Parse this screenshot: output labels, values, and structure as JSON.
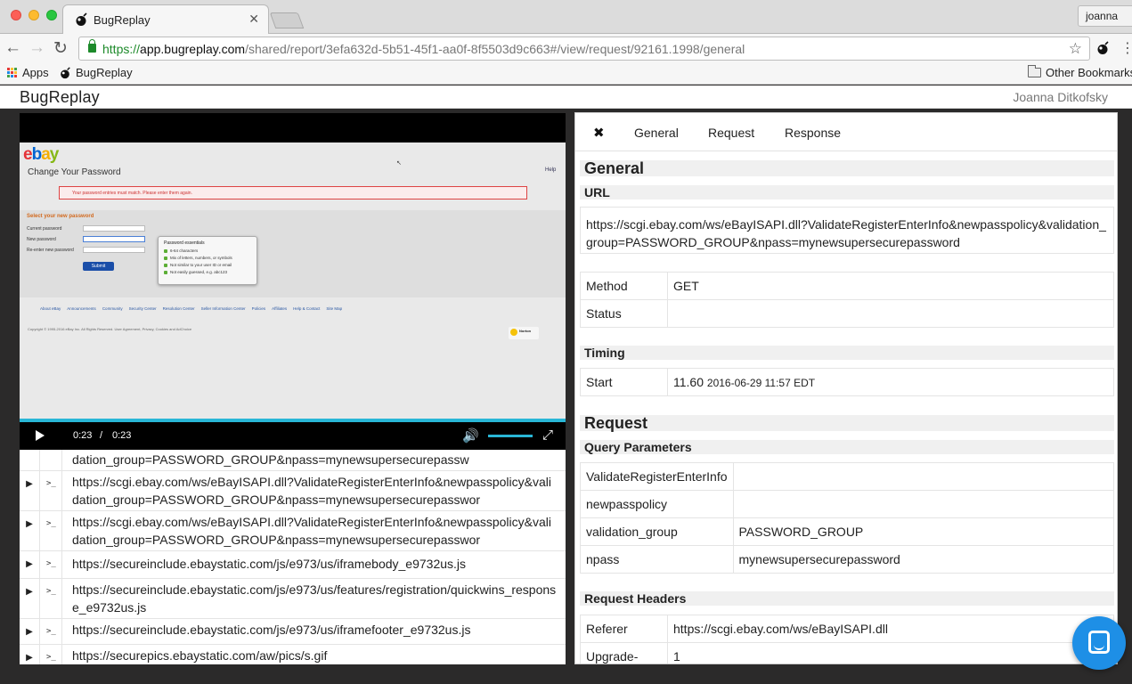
{
  "browser": {
    "tab_title": "BugReplay",
    "tab_close": "✕",
    "profile_name": "joanna",
    "url_scheme": "https://",
    "url_host": "app.bugreplay.com",
    "url_path": "/shared/report/3efa632d-5b51-45f1-aa0f-8f5503d9c663#/view/request/92161.1998/general",
    "bookmarks": {
      "apps": "Apps",
      "bugreplay": "BugReplay",
      "other": "Other Bookmarks"
    }
  },
  "app": {
    "brand": "BugReplay",
    "user": "Joanna Ditkofsky"
  },
  "video": {
    "time_current": "0:23",
    "time_separator": "/",
    "time_total": "0:23",
    "progress": 1.0,
    "frame": {
      "title": "Change Your Password",
      "help": "Help",
      "error": "Your password entries must match. Please enter them again.",
      "section_title": "Select your new password",
      "labels": [
        "Current password",
        "New password",
        "Re-enter new password"
      ],
      "submit": "Submit",
      "tip_title": "Password essentials",
      "tip_items": [
        "6-64 characters",
        "Mix of letters, numbers, or symbols",
        "Not similar to your user ID or email",
        "Not easily guessed, e.g. abc123"
      ],
      "links": [
        "About eBay",
        "Announcements",
        "Community",
        "Security Center",
        "Resolution Center",
        "Seller Information Center",
        "Policies",
        "Affiliates",
        "Help & Contact",
        "Site Map"
      ],
      "copyright": "Copyright © 1995-2016 eBay Inc. All Rights Reserved. User Agreement, Privacy, Cookies and AdChoice",
      "norton": "Norton"
    }
  },
  "requests": [
    "https://scgi.ebay.com/ws/eBayISAPI.dll?ValidateRegisterEnterInfo&newpasspolicy&validation_group=PASSWORD_GROUP&npass=mynewsupersecurepassw",
    "https://scgi.ebay.com/ws/eBayISAPI.dll?ValidateRegisterEnterInfo&newpasspolicy&validation_group=PASSWORD_GROUP&npass=mynewsupersecurepasswor",
    "https://scgi.ebay.com/ws/eBayISAPI.dll?ValidateRegisterEnterInfo&newpasspolicy&validation_group=PASSWORD_GROUP&npass=mynewsupersecurepasswor",
    "https://secureinclude.ebaystatic.com/js/e973/us/iframebody_e9732us.js",
    "https://secureinclude.ebaystatic.com/js/e973/us/features/registration/quickwins_response_e9732us.js",
    "https://secureinclude.ebaystatic.com/js/e973/us/iframefooter_e9732us.js",
    "https://securepics.ebaystatic.com/aw/pics/s.gif"
  ],
  "inspector": {
    "close": "✖",
    "tabs": {
      "general": "General",
      "request": "Request",
      "response": "Response"
    },
    "general_heading": "General",
    "url_heading": "URL",
    "url_value": "https://scgi.ebay.com/ws/eBayISAPI.dll?ValidateRegisterEnterInfo&newpasspolicy&validation_group=PASSWORD_GROUP&npass=mynewsupersecurepassword",
    "method_label": "Method",
    "method_value": "GET",
    "status_label": "Status",
    "status_value": "",
    "timing_heading": "Timing",
    "start_label": "Start",
    "start_value": "11.60",
    "start_date": "2016-06-29 11:57 EDT",
    "request_heading": "Request",
    "query_heading": "Query Parameters",
    "query_params": [
      {
        "name": "ValidateRegisterEnterInfo",
        "value": ""
      },
      {
        "name": "newpasspolicy",
        "value": ""
      },
      {
        "name": "validation_group",
        "value": "PASSWORD_GROUP"
      },
      {
        "name": "npass",
        "value": "mynewsupersecurepassword"
      }
    ],
    "headers_heading": "Request Headers",
    "headers": [
      {
        "name": "Referer",
        "value": "https://scgi.ebay.com/ws/eBayISAPI.dll"
      },
      {
        "name": "Upgrade-",
        "value": "1"
      }
    ]
  }
}
